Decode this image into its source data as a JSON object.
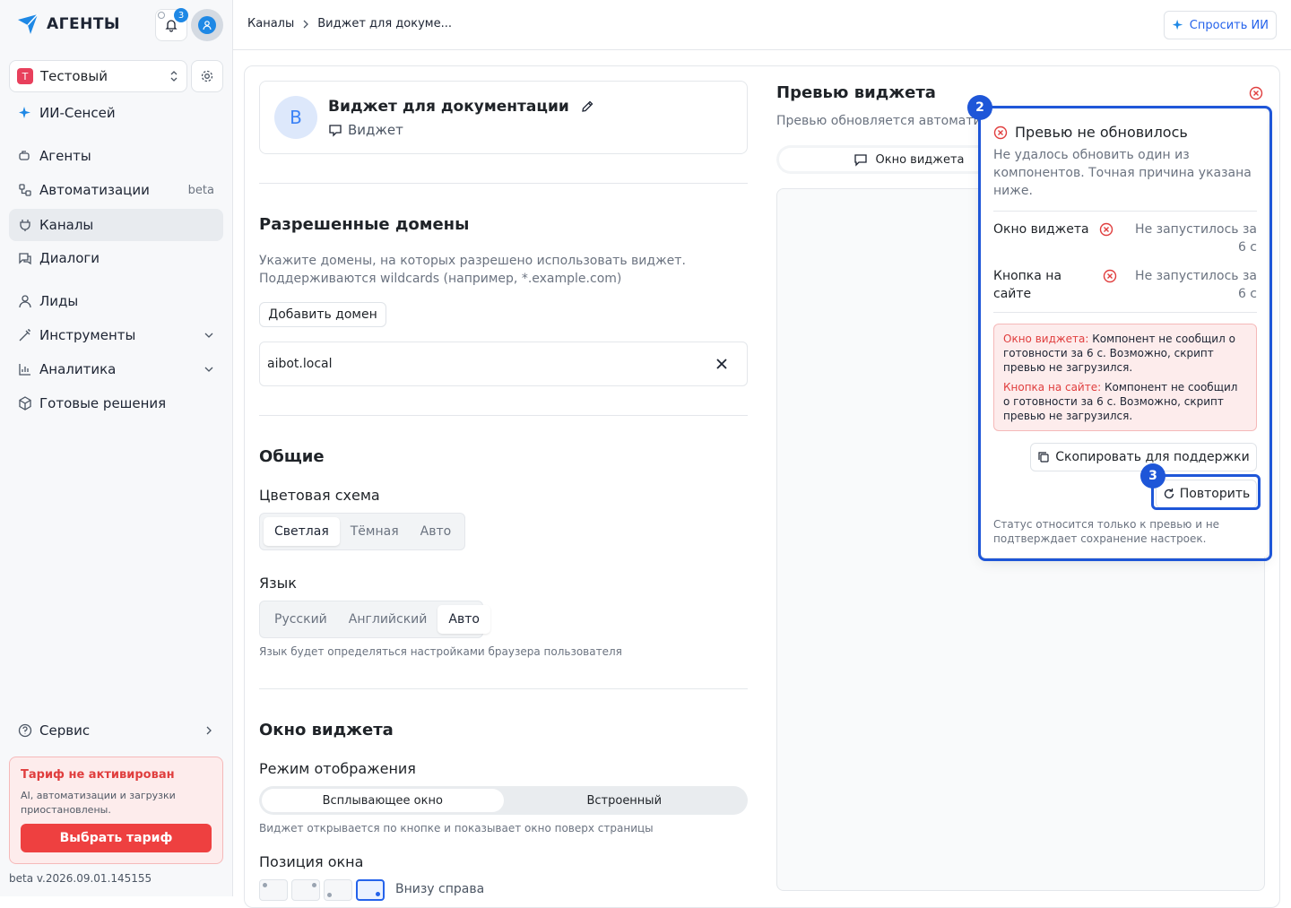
{
  "sidebar": {
    "logo": "АГЕНТЫ",
    "notifications_count": "3",
    "workspace": {
      "initial": "Т",
      "name": "Тестовый"
    },
    "items": [
      {
        "label": "ИИ-Сенсей"
      },
      {
        "label": "Агенты"
      },
      {
        "label": "Автоматизации",
        "extra": "beta"
      },
      {
        "label": "Каналы"
      },
      {
        "label": "Диалоги"
      },
      {
        "label": "Лиды"
      },
      {
        "label": "Инструменты"
      },
      {
        "label": "Аналитика"
      },
      {
        "label": "Готовые решения"
      }
    ],
    "service": "Сервис",
    "plan": {
      "title": "Тариф не активирован",
      "desc": "AI, автоматизации и загрузки приостановлены.",
      "button": "Выбрать тариф"
    },
    "version": "beta v.2026.09.01.145155"
  },
  "topbar": {
    "crumb1": "Каналы",
    "crumb2": "Виджет для докуме...",
    "ask": "Спросить ИИ"
  },
  "widget": {
    "initial": "В",
    "title": "Виджет для документации",
    "type": "Виджет"
  },
  "domains": {
    "title": "Разрешенные домены",
    "desc1": "Укажите домены, на которых разрешено использовать виджет.",
    "desc2": "Поддерживаются wildcards (например, *.example.com)",
    "add": "Добавить домен",
    "value": "aibot.local"
  },
  "general": {
    "title": "Общие",
    "scheme_label": "Цветовая схема",
    "scheme": [
      "Светлая",
      "Тёмная",
      "Авто"
    ],
    "lang_label": "Язык",
    "lang": [
      "Русский",
      "Английский",
      "Авто"
    ],
    "lang_hint": "Язык будет определяться настройками браузера пользователя"
  },
  "window": {
    "title": "Окно виджета",
    "mode_label": "Режим отображения",
    "modes": [
      "Всплывающее окно",
      "Встроенный"
    ],
    "mode_hint": "Виджет открывается по кнопке и показывает окно поверх страницы",
    "pos_label": "Позиция окна",
    "pos_value": "Внизу справа"
  },
  "preview": {
    "title": "Превью виджета",
    "sub": "Превью обновляется автоматически",
    "tab": "Окно виджета"
  },
  "popup": {
    "marker": "2",
    "title": "Превью не обновилось",
    "desc": "Не удалось обновить один из компонентов. Точная причина указана ниже.",
    "rows": [
      {
        "name": "Окно виджета",
        "status": "Не запустилось за 6 с"
      },
      {
        "name": "Кнопка на сайте",
        "status": "Не запустилось за 6 с"
      }
    ],
    "errors": [
      {
        "title": "Окно виджета:",
        "text": "Компонент не сообщил о готовности за 6 с. Возможно, скрипт превью не загрузился."
      },
      {
        "title": "Кнопка на сайте:",
        "text": "Компонент не сообщил о готовности за 6 с. Возможно, скрипт превью не загрузился."
      }
    ],
    "copy": "Скопировать для поддержки",
    "retry_marker": "3",
    "retry": "Повторить",
    "footer": "Статус относится только к превью и не подтверждает сохранение настроек."
  }
}
